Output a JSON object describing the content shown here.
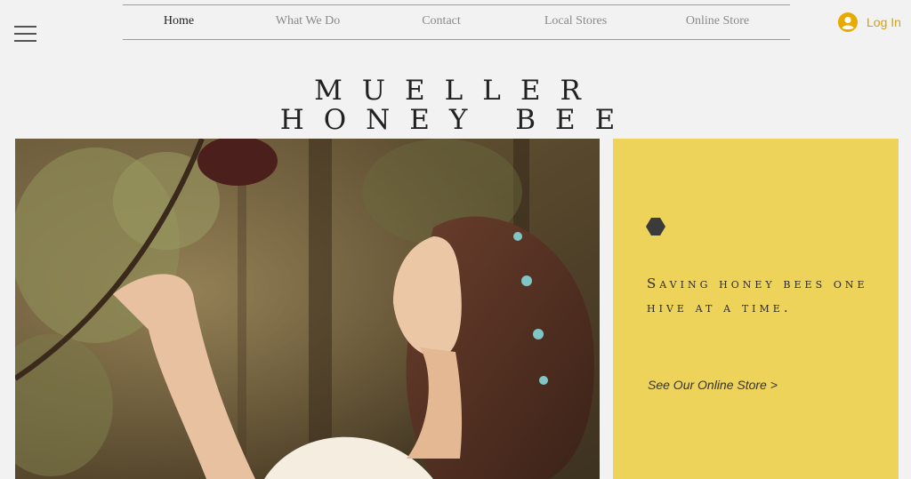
{
  "nav": {
    "items": [
      {
        "label": "Home",
        "active": true
      },
      {
        "label": "What We Do",
        "active": false
      },
      {
        "label": "Contact",
        "active": false
      },
      {
        "label": "Local Stores",
        "active": false
      },
      {
        "label": "Online Store",
        "active": false
      }
    ]
  },
  "login": {
    "label": "Log In",
    "icon": "user-avatar-icon"
  },
  "menu": {
    "icon": "hamburger-menu-icon"
  },
  "header": {
    "title_line1": "MUELLER",
    "title_line2": "HONEY BEE"
  },
  "promo": {
    "tagline": "Saving honey bees one hive at a time.",
    "link_label": "See Our Online Store >",
    "icon": "hexagon-icon",
    "background": "#eed35a"
  },
  "colors": {
    "accent": "#d9a000",
    "panel": "#eed35a",
    "page": "#f2f2f2"
  }
}
